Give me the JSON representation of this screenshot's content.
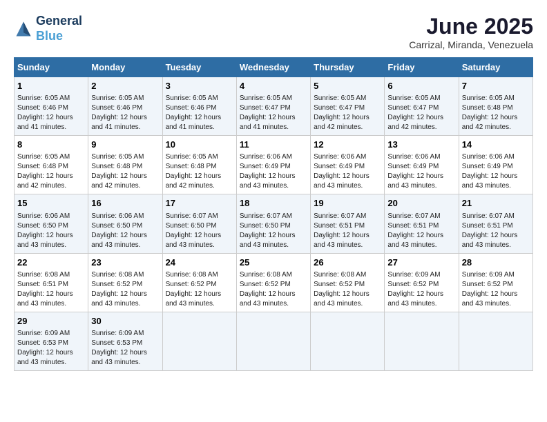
{
  "logo": {
    "line1": "General",
    "line2": "Blue"
  },
  "title": "June 2025",
  "subtitle": "Carrizal, Miranda, Venezuela",
  "days_header": [
    "Sunday",
    "Monday",
    "Tuesday",
    "Wednesday",
    "Thursday",
    "Friday",
    "Saturday"
  ],
  "weeks": [
    [
      {
        "day": "1",
        "sunrise": "6:05 AM",
        "sunset": "6:46 PM",
        "daylight": "12 hours and 41 minutes."
      },
      {
        "day": "2",
        "sunrise": "6:05 AM",
        "sunset": "6:46 PM",
        "daylight": "12 hours and 41 minutes."
      },
      {
        "day": "3",
        "sunrise": "6:05 AM",
        "sunset": "6:46 PM",
        "daylight": "12 hours and 41 minutes."
      },
      {
        "day": "4",
        "sunrise": "6:05 AM",
        "sunset": "6:47 PM",
        "daylight": "12 hours and 41 minutes."
      },
      {
        "day": "5",
        "sunrise": "6:05 AM",
        "sunset": "6:47 PM",
        "daylight": "12 hours and 42 minutes."
      },
      {
        "day": "6",
        "sunrise": "6:05 AM",
        "sunset": "6:47 PM",
        "daylight": "12 hours and 42 minutes."
      },
      {
        "day": "7",
        "sunrise": "6:05 AM",
        "sunset": "6:48 PM",
        "daylight": "12 hours and 42 minutes."
      }
    ],
    [
      {
        "day": "8",
        "sunrise": "6:05 AM",
        "sunset": "6:48 PM",
        "daylight": "12 hours and 42 minutes."
      },
      {
        "day": "9",
        "sunrise": "6:05 AM",
        "sunset": "6:48 PM",
        "daylight": "12 hours and 42 minutes."
      },
      {
        "day": "10",
        "sunrise": "6:05 AM",
        "sunset": "6:48 PM",
        "daylight": "12 hours and 42 minutes."
      },
      {
        "day": "11",
        "sunrise": "6:06 AM",
        "sunset": "6:49 PM",
        "daylight": "12 hours and 43 minutes."
      },
      {
        "day": "12",
        "sunrise": "6:06 AM",
        "sunset": "6:49 PM",
        "daylight": "12 hours and 43 minutes."
      },
      {
        "day": "13",
        "sunrise": "6:06 AM",
        "sunset": "6:49 PM",
        "daylight": "12 hours and 43 minutes."
      },
      {
        "day": "14",
        "sunrise": "6:06 AM",
        "sunset": "6:49 PM",
        "daylight": "12 hours and 43 minutes."
      }
    ],
    [
      {
        "day": "15",
        "sunrise": "6:06 AM",
        "sunset": "6:50 PM",
        "daylight": "12 hours and 43 minutes."
      },
      {
        "day": "16",
        "sunrise": "6:06 AM",
        "sunset": "6:50 PM",
        "daylight": "12 hours and 43 minutes."
      },
      {
        "day": "17",
        "sunrise": "6:07 AM",
        "sunset": "6:50 PM",
        "daylight": "12 hours and 43 minutes."
      },
      {
        "day": "18",
        "sunrise": "6:07 AM",
        "sunset": "6:50 PM",
        "daylight": "12 hours and 43 minutes."
      },
      {
        "day": "19",
        "sunrise": "6:07 AM",
        "sunset": "6:51 PM",
        "daylight": "12 hours and 43 minutes."
      },
      {
        "day": "20",
        "sunrise": "6:07 AM",
        "sunset": "6:51 PM",
        "daylight": "12 hours and 43 minutes."
      },
      {
        "day": "21",
        "sunrise": "6:07 AM",
        "sunset": "6:51 PM",
        "daylight": "12 hours and 43 minutes."
      }
    ],
    [
      {
        "day": "22",
        "sunrise": "6:08 AM",
        "sunset": "6:51 PM",
        "daylight": "12 hours and 43 minutes."
      },
      {
        "day": "23",
        "sunrise": "6:08 AM",
        "sunset": "6:52 PM",
        "daylight": "12 hours and 43 minutes."
      },
      {
        "day": "24",
        "sunrise": "6:08 AM",
        "sunset": "6:52 PM",
        "daylight": "12 hours and 43 minutes."
      },
      {
        "day": "25",
        "sunrise": "6:08 AM",
        "sunset": "6:52 PM",
        "daylight": "12 hours and 43 minutes."
      },
      {
        "day": "26",
        "sunrise": "6:08 AM",
        "sunset": "6:52 PM",
        "daylight": "12 hours and 43 minutes."
      },
      {
        "day": "27",
        "sunrise": "6:09 AM",
        "sunset": "6:52 PM",
        "daylight": "12 hours and 43 minutes."
      },
      {
        "day": "28",
        "sunrise": "6:09 AM",
        "sunset": "6:52 PM",
        "daylight": "12 hours and 43 minutes."
      }
    ],
    [
      {
        "day": "29",
        "sunrise": "6:09 AM",
        "sunset": "6:53 PM",
        "daylight": "12 hours and 43 minutes."
      },
      {
        "day": "30",
        "sunrise": "6:09 AM",
        "sunset": "6:53 PM",
        "daylight": "12 hours and 43 minutes."
      },
      null,
      null,
      null,
      null,
      null
    ]
  ],
  "labels": {
    "sunrise": "Sunrise:",
    "sunset": "Sunset:",
    "daylight": "Daylight:"
  }
}
